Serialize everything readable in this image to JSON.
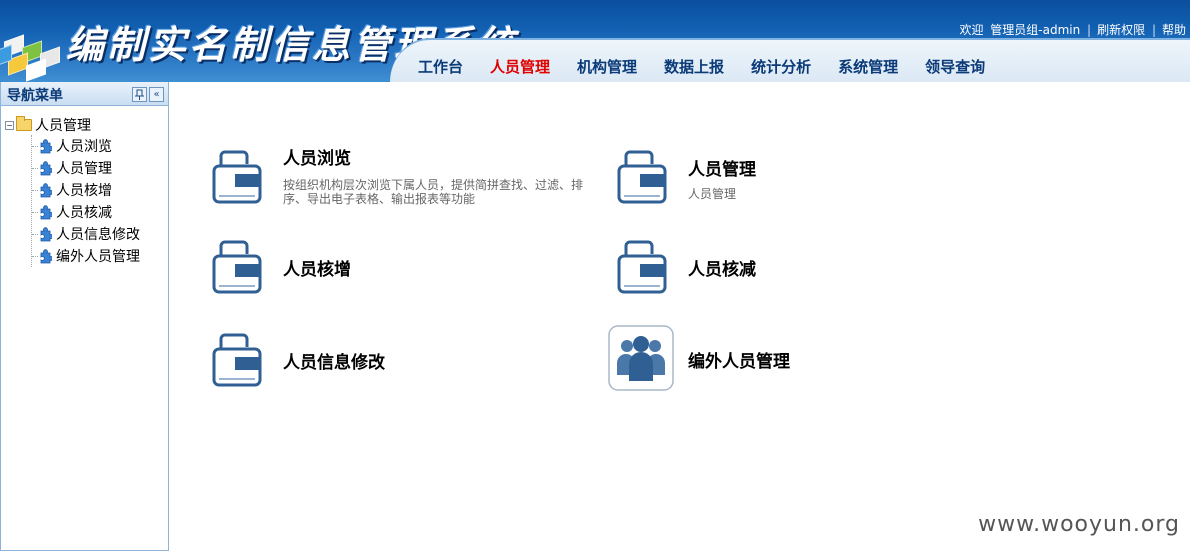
{
  "header": {
    "app_title": "编制实名制信息管理系统",
    "welcome": "欢迎",
    "user": "管理员组-admin",
    "refresh_permissions": "刷新权限",
    "help": "帮助"
  },
  "topnav": {
    "items": [
      "工作台",
      "人员管理",
      "机构管理",
      "数据上报",
      "统计分析",
      "系统管理",
      "领导查询"
    ],
    "active": "人员管理"
  },
  "sidebar": {
    "title": "导航菜单",
    "pin_icon": "pin-icon",
    "collapse_icon": "double-chevron-left-icon",
    "tree": {
      "root_label": "人员管理",
      "root_toggle": "⊟",
      "children": [
        "人员浏览",
        "人员管理",
        "人员核增",
        "人员核减",
        "人员信息修改",
        "编外人员管理"
      ]
    }
  },
  "main": {
    "cards": [
      {
        "title": "人员浏览",
        "desc": "按组织机构层次浏览下属人员，提供简拼查找、过滤、排序、导出电子表格、输出报表等功能",
        "icon": "folder-card-icon"
      },
      {
        "title": "人员管理",
        "desc": "人员管理",
        "icon": "folder-card-icon"
      },
      {
        "title": "人员核增",
        "desc": "",
        "icon": "folder-card-icon"
      },
      {
        "title": "人员核减",
        "desc": "",
        "icon": "folder-card-icon"
      },
      {
        "title": "人员信息修改",
        "desc": "",
        "icon": "folder-card-icon"
      },
      {
        "title": "编外人员管理",
        "desc": "",
        "icon": "people-group-icon"
      }
    ]
  },
  "watermark": "www.wooyun.org",
  "colors": {
    "header_blue": "#1260b2",
    "nav_text": "#0a3a78",
    "nav_active": "#e00000",
    "icon_blue": "#2f5f93"
  }
}
